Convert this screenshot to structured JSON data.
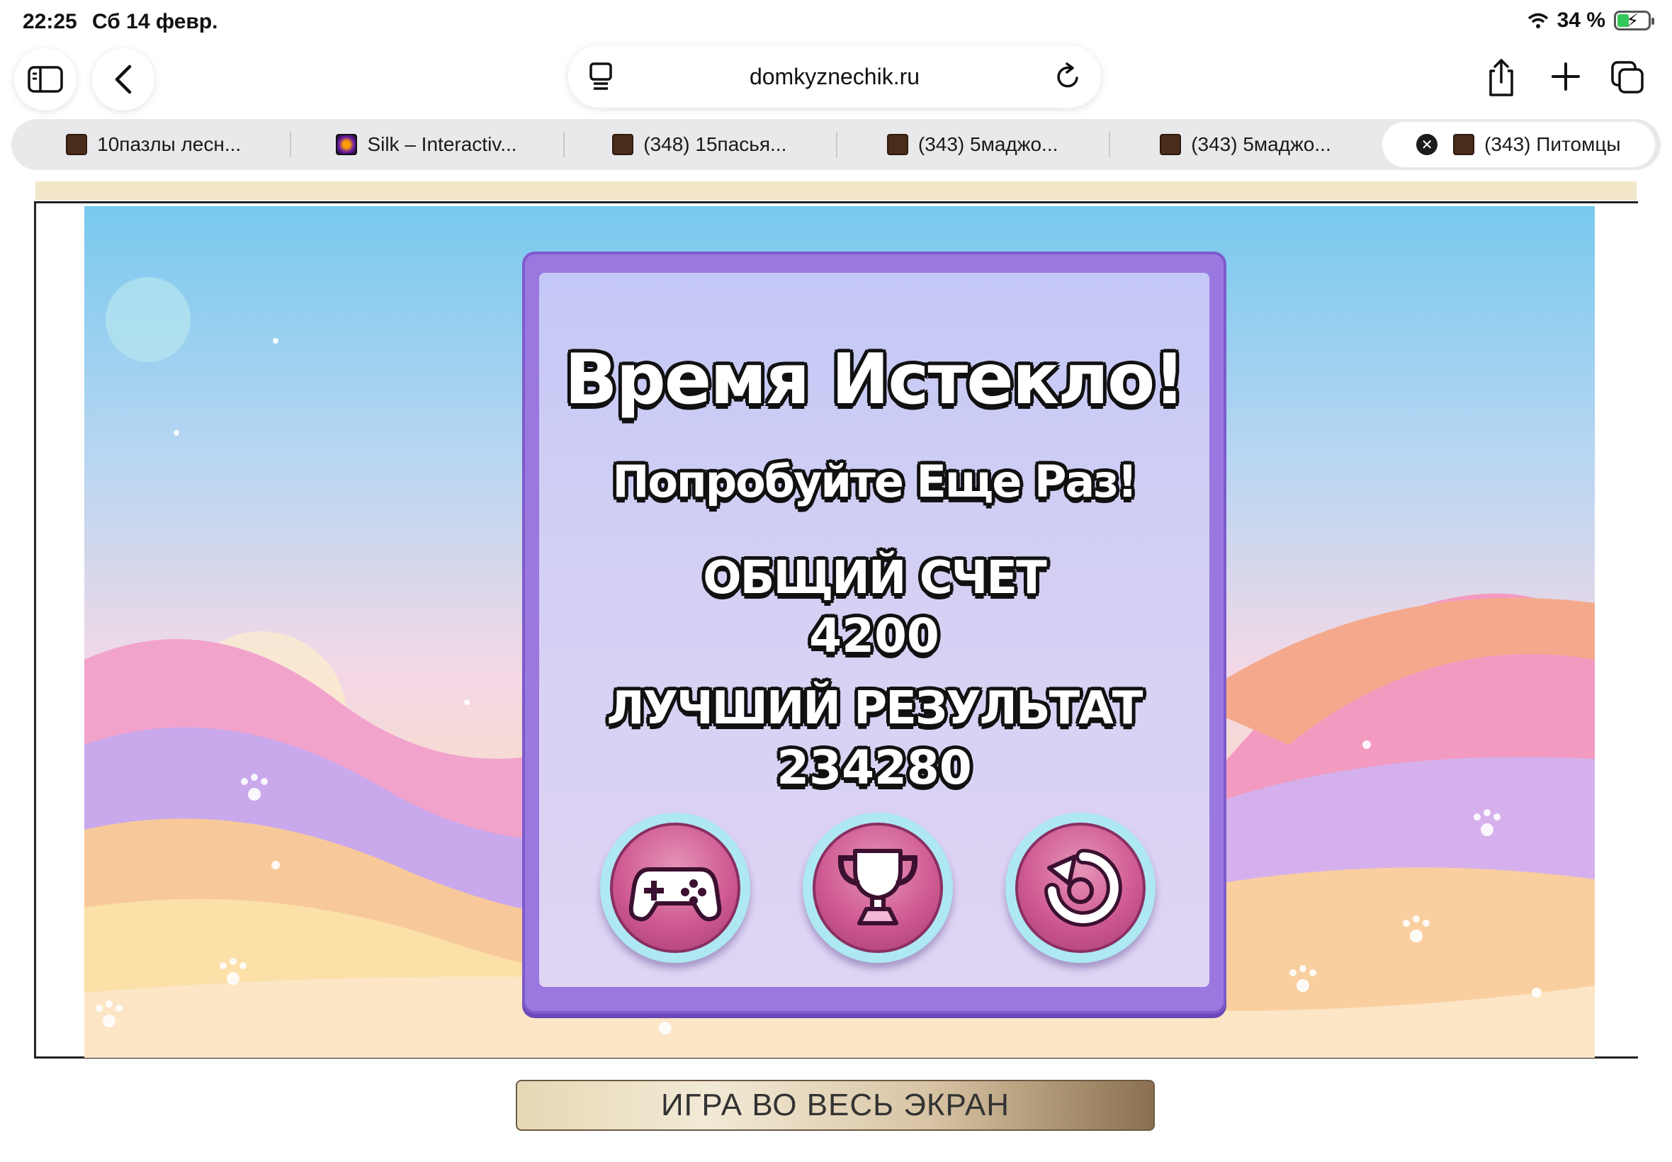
{
  "status_bar": {
    "time": "22:25",
    "date": "Сб 14 февр.",
    "battery_percent": "34 %",
    "battery_level": 0.34
  },
  "toolbar": {
    "url": "domkyznechik.ru"
  },
  "tabs": [
    {
      "label": "10пазлы лесн...",
      "icon": "game-favicon"
    },
    {
      "label": "Silk – Interactiv...",
      "icon": "silk-favicon"
    },
    {
      "label": "(348) 15пасья...",
      "icon": "game-favicon"
    },
    {
      "label": "(343) 5маджо...",
      "icon": "game-favicon"
    },
    {
      "label": "(343) 5маджо...",
      "icon": "game-favicon"
    },
    {
      "label": "(343) Питомцы",
      "icon": "game-favicon",
      "active": true
    }
  ],
  "game": {
    "title": "Время Истекло!",
    "subtitle": "Попробуйте Еще Раз!",
    "total_score_label": "ОБЩИЙ СЧЕТ",
    "total_score_value": "4200",
    "best_label": "ЛУЧШИЙ РЕЗУЛЬТАТ",
    "best_value": "234280",
    "buttons": [
      "gamepad-icon",
      "trophy-icon",
      "restart-icon"
    ]
  },
  "fullscreen_button": {
    "label": "ИГРА ВО ВЕСЬ ЭКРАН"
  },
  "colors": {
    "panel": "#9b78e0",
    "button": "#cf5a92"
  }
}
